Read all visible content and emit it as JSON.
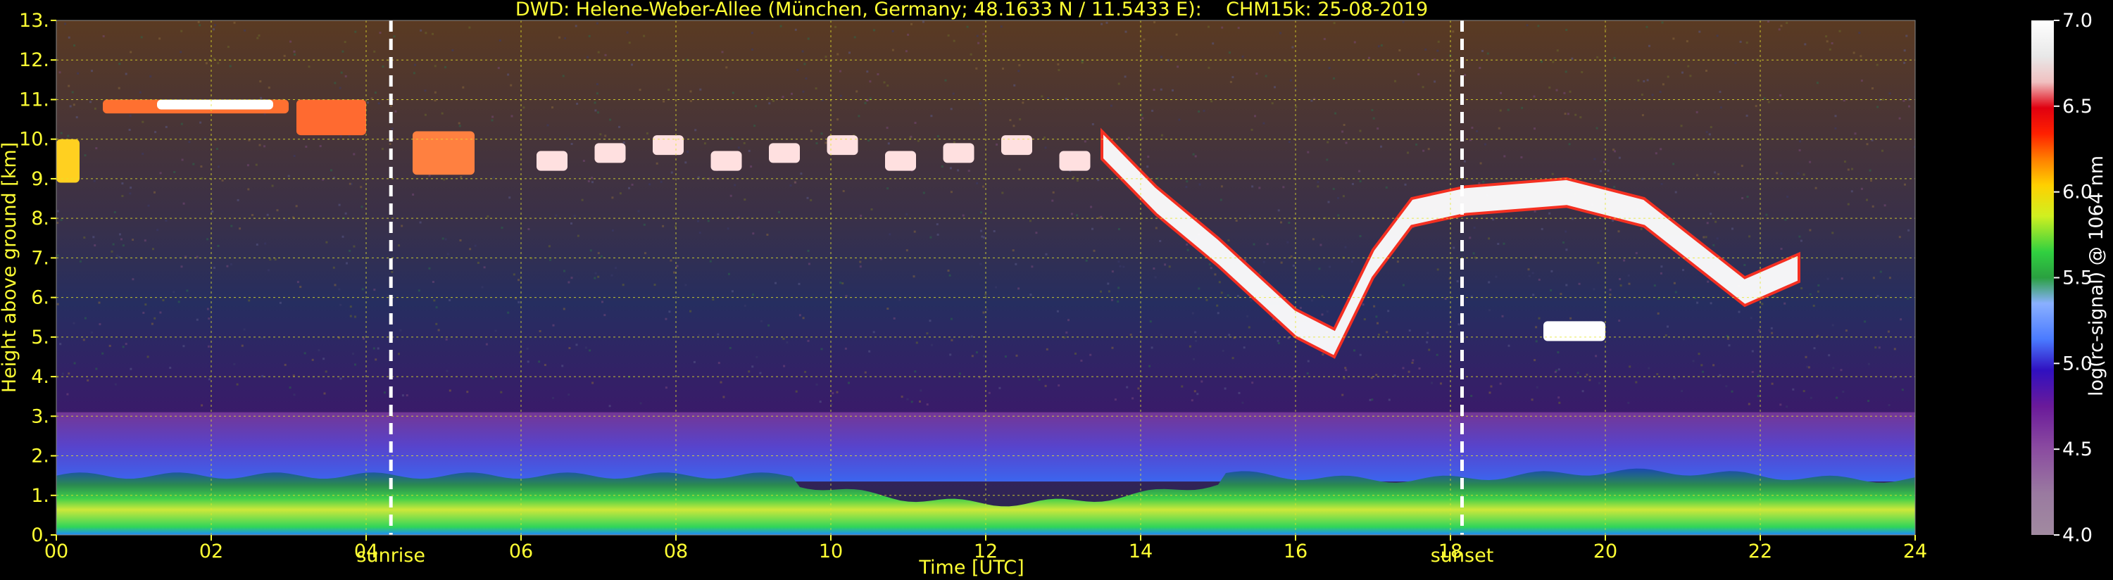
{
  "chart_data": {
    "type": "heatmap",
    "title": "DWD: Helene-Weber-Allee (München, Germany; 48.1633 N / 11.5433 E):    CHM15k: 25-08-2019",
    "xlabel": "Time [UTC]",
    "ylabel": "Height above ground [km]",
    "xlim": [
      0,
      24
    ],
    "ylim": [
      0,
      13
    ],
    "x_ticks": [
      0,
      2,
      4,
      6,
      8,
      10,
      12,
      14,
      16,
      18,
      20,
      22,
      24
    ],
    "x_tick_labels": [
      "00",
      "02",
      "04",
      "06",
      "08",
      "10",
      "12",
      "14",
      "16",
      "18",
      "20",
      "22",
      "24"
    ],
    "y_ticks": [
      0,
      1,
      2,
      3,
      4,
      5,
      6,
      7,
      8,
      9,
      10,
      11,
      12,
      13
    ],
    "y_tick_labels": [
      "0.",
      "1.",
      "2.",
      "3.",
      "4.",
      "5.",
      "6.",
      "7.",
      "8.",
      "9.",
      "10.",
      "11.",
      "12.",
      "13."
    ],
    "grid": true,
    "colorbar": {
      "label": "log(rc-signal) @ 1064 nm",
      "range": [
        4.0,
        7.0
      ],
      "ticks": [
        4.0,
        4.5,
        5.0,
        5.5,
        6.0,
        6.5,
        7.0
      ],
      "tick_labels": [
        "4.0",
        "4.5",
        "5.0",
        "5.5",
        "6.0",
        "6.5",
        "7.0"
      ]
    },
    "annotations": [
      {
        "label": "sunrise",
        "x": 4.32
      },
      {
        "label": "sunset",
        "x": 18.15
      }
    ],
    "features": {
      "boundary_layer_top_km": 1.5,
      "residual_layer_top_km": 3.1,
      "cirrus_early_km": [
        9.5,
        11.0
      ],
      "cloud_late_km": [
        5.2,
        9.0
      ]
    }
  }
}
